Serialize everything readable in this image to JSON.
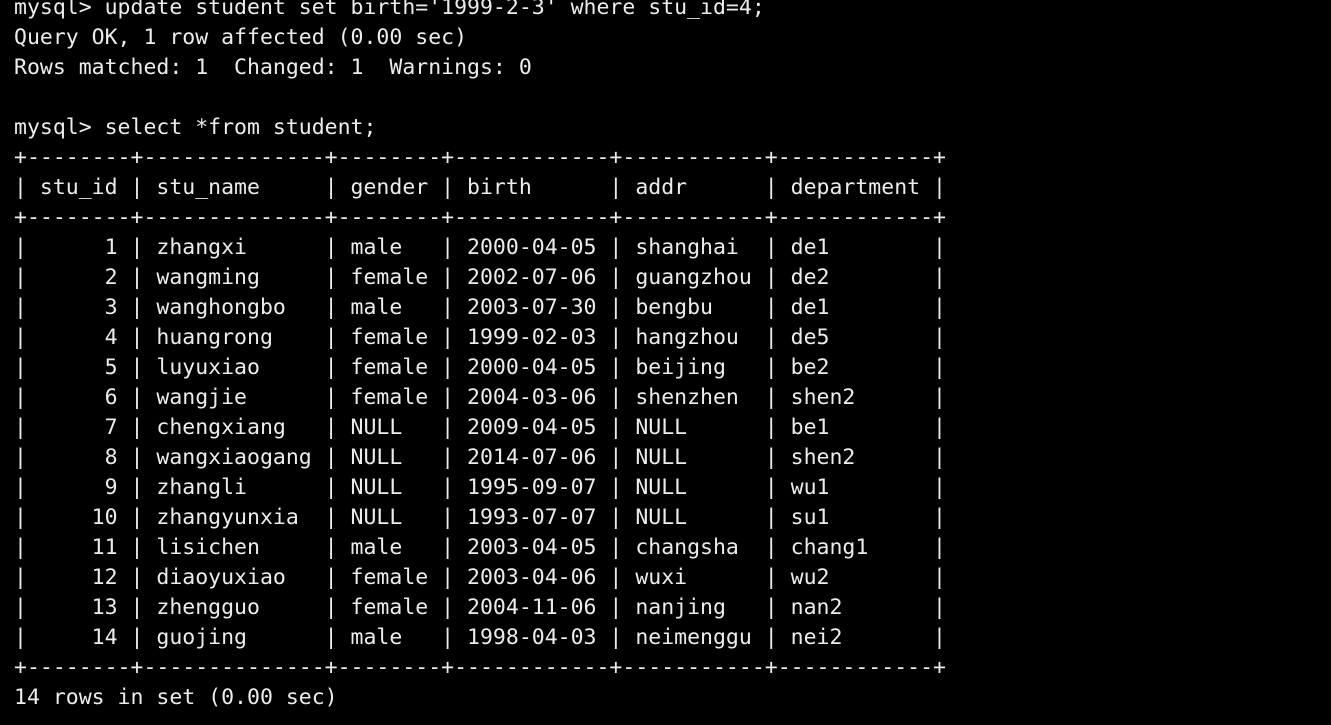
{
  "terminal": {
    "bg_color": "#000000",
    "text_color": "#ececec",
    "lines": [
      "mysql> update student set birth='1999-2-3' where stu_id=4;",
      "Query OK, 1 row affected (0.00 sec)",
      "Rows matched: 1  Changed: 1  Warnings: 0",
      "",
      "mysql> select *from student;",
      "+--------+--------------+--------+------------+-----------+------------+",
      "| stu_id | stu_name     | gender | birth      | addr      | department |",
      "+--------+--------------+--------+------------+-----------+------------+",
      "|      1 | zhangxi      | male   | 2000-04-05 | shanghai  | de1        |",
      "|      2 | wangming     | female | 2002-07-06 | guangzhou | de2        |",
      "|      3 | wanghongbo   | male   | 2003-07-30 | bengbu    | de1        |",
      "|      4 | huangrong    | female | 1999-02-03 | hangzhou  | de5        |",
      "|      5 | luyuxiao     | female | 2000-04-05 | beijing   | be2        |",
      "|      6 | wangjie      | female | 2004-03-06 | shenzhen  | shen2      |",
      "|      7 | chengxiang   | NULL   | 2009-04-05 | NULL      | be1        |",
      "|      8 | wangxiaogang | NULL   | 2014-07-06 | NULL      | shen2      |",
      "|      9 | zhangli      | NULL   | 1995-09-07 | NULL      | wu1        |",
      "|     10 | zhangyunxia  | NULL   | 1993-07-07 | NULL      | su1        |",
      "|     11 | lisichen     | male   | 2003-04-05 | changsha  | chang1     |",
      "|     12 | diaoyuxiao   | female | 2003-04-06 | wuxi      | wu2        |",
      "|     13 | zhengguo     | female | 2004-11-06 | nanjing   | nan2       |",
      "|     14 | guojing      | male   | 1998-04-03 | neimenggu | nei2       |",
      "+--------+--------------+--------+------------+-----------+------------+",
      "14 rows in set (0.00 sec)"
    ]
  }
}
